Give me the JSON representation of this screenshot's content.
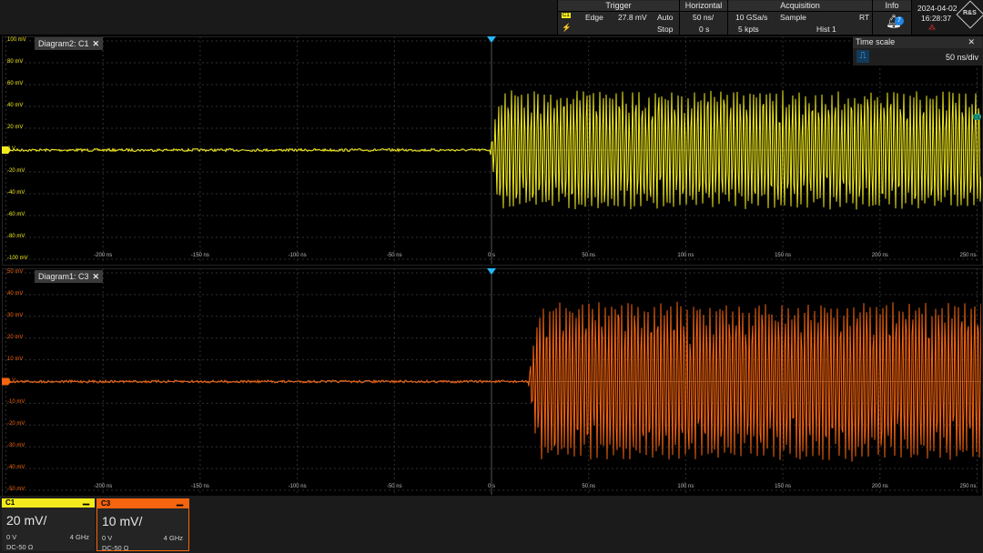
{
  "toolbar": {
    "trigger": {
      "title": "Trigger",
      "channel": "C1",
      "type": "Edge",
      "level": "27.8 mV",
      "mode": "Auto",
      "state": "Stop"
    },
    "horizontal": {
      "title": "Horizontal",
      "scale": "50 ns/",
      "position": "0 s"
    },
    "acquisition": {
      "title": "Acquisition",
      "rate": "10 GSa/s",
      "mode": "Sample",
      "mode_flag": "RT",
      "points": "5 kpts",
      "hist": "Hist 1"
    },
    "info": {
      "title": "Info",
      "count": "7"
    },
    "clock": {
      "date": "2024-04-02",
      "time": "16:28:37"
    },
    "logo": "R&S"
  },
  "diagram2": {
    "tab_label": "Diagram2: C1",
    "close": "✕",
    "y_labels": [
      "100 mV",
      "80 mV",
      "60 mV",
      "40 mV",
      "20 mV",
      "0 V",
      "-20 mV",
      "-40 mV",
      "-60 mV",
      "-80 mV",
      "-100 mV"
    ],
    "x_labels": [
      "-200 ns",
      "-150 ns",
      "-100 ns",
      "-50 ns",
      "0 s",
      "50 ns",
      "100 ns",
      "150 ns",
      "200 ns",
      "250 ns"
    ],
    "trace_color": "#f2ea1c",
    "marker": "C1"
  },
  "diagram1": {
    "tab_label": "Diagram1: C3",
    "close": "✕",
    "y_labels": [
      "50 mV",
      "40 mV",
      "30 mV",
      "20 mV",
      "10 mV",
      "0 V",
      "-10 mV",
      "-20 mV",
      "-30 mV",
      "-40 mV",
      "-50 mV"
    ],
    "x_labels": [
      "-200 ns",
      "-150 ns",
      "-100 ns",
      "-50 ns",
      "0 s",
      "50 ns",
      "100 ns",
      "150 ns",
      "200 ns",
      "250 ns"
    ],
    "trace_color": "#f5650f"
  },
  "time_scale": {
    "title": "Time scale",
    "close": "✕",
    "value": "50 ns/div"
  },
  "channels": [
    {
      "name": "C1",
      "scale": "20 mV/",
      "offset": "0 V",
      "bandwidth": "4 GHz",
      "coupling": "DC-50 Ω",
      "color": "#f2ea1c"
    },
    {
      "name": "C3",
      "scale": "10 mV/",
      "offset": "0 V",
      "bandwidth": "4 GHz",
      "coupling": "DC-50 Ω",
      "color": "#f5650f"
    }
  ]
}
